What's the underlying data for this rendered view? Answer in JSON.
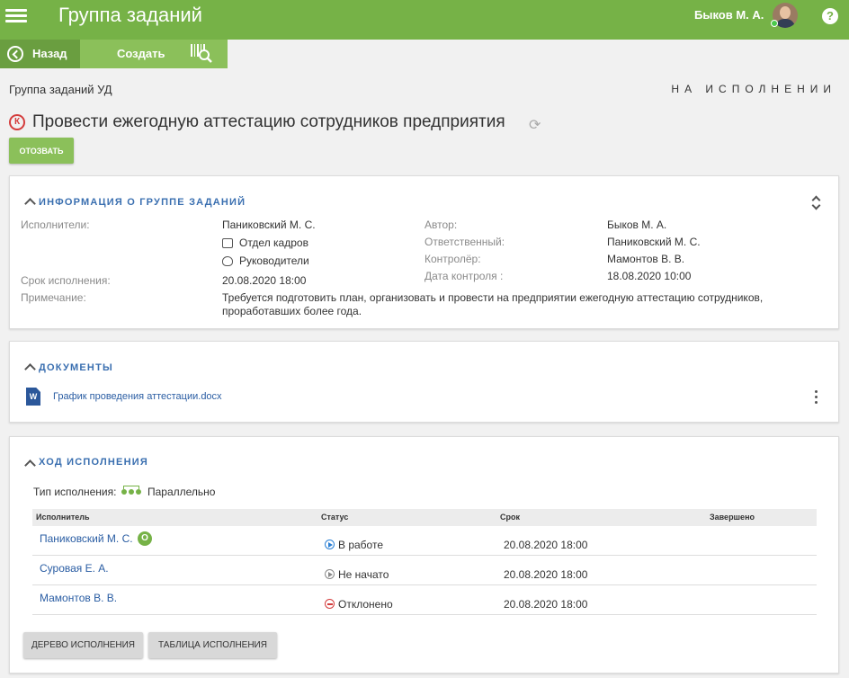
{
  "header": {
    "title": "Группа заданий",
    "user_name": "Быков М. А."
  },
  "toolbar": {
    "back_label": "Назад",
    "create_label": "Создать"
  },
  "page": {
    "group_label": "Группа заданий УД",
    "status": "НА ИСПОЛНЕНИИ",
    "priority_badge": "К",
    "task_title": "Провести ежегодную аттестацию сотрудников предприятия",
    "recall_button": "ОТОЗВАТЬ"
  },
  "info": {
    "section_title": "ИНФОРМАЦИЯ О ГРУППЕ ЗАДАНИЙ",
    "executors_label": "Исполнители:",
    "executors": [
      "Паниковский М. С.",
      "Отдел кадров",
      "Руководители"
    ],
    "deadline_label": "Срок исполнения:",
    "deadline": "20.08.2020 18:00",
    "note_label": "Примечание:",
    "note": "Требуется подготовить план, организовать и провести на предприятии ежегодную аттестацию сотрудников, проработавших более года.",
    "author_label": "Автор:",
    "author": "Быков М. А.",
    "responsible_label": "Ответственный:",
    "responsible": "Паниковский М. С.",
    "controller_label": "Контролёр:",
    "controller": "Мамонтов В. В.",
    "control_date_label": "Дата контроля :",
    "control_date": "18.08.2020 10:00"
  },
  "documents": {
    "section_title": "ДОКУМЕНТЫ",
    "file_icon_letter": "W",
    "files": [
      "График проведения аттестации.docx"
    ]
  },
  "progress": {
    "section_title": "ХОД ИСПОЛНЕНИЯ",
    "exec_type_label": "Тип исполнения:",
    "exec_type": "Параллельно",
    "columns": [
      "Исполнитель",
      "Статус",
      "Срок",
      "Завершено"
    ],
    "rows": [
      {
        "name": "Паниковский М. С.",
        "badge": "О",
        "status": "В работе",
        "due": "20.08.2020 18:00",
        "done": ""
      },
      {
        "name": "Суровая Е. А.",
        "status": "Не начато",
        "due": "20.08.2020 18:00",
        "done": ""
      },
      {
        "name": "Мамонтов В. В.",
        "status": "Отклонено",
        "due": "20.08.2020 18:00",
        "done": ""
      }
    ],
    "tree_button": "ДЕРЕВО ИСПОЛНЕНИЯ",
    "table_button": "ТАБЛИЦА ИСПОЛНЕНИЯ"
  },
  "colors": {
    "brand_green": "#76b247",
    "link_blue": "#2a5da3",
    "status_in_work": "#2a7fd4",
    "status_rejected": "#d43c3c"
  }
}
